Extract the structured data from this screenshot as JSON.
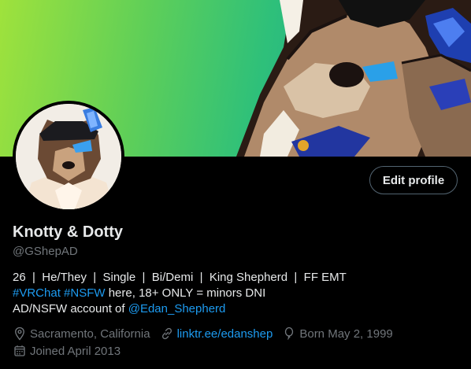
{
  "profile": {
    "display_name": "Knotty & Dotty",
    "handle": "@GShepAD",
    "edit_button_label": "Edit profile",
    "bio": {
      "line1": "26  |  He/They  |  Single  |  Bi/Demi  |  King Shepherd  |  FF EMT",
      "hashtag_vrchat": "#VRChat",
      "hashtag_nsfw": "#NSFW",
      "line2_rest": " here, 18+ ONLY = minors DNI",
      "line3_prefix": "AD/NSFW account of ",
      "mention": "@Edan_Shepherd"
    },
    "location": "Sacramento, California",
    "website": "linktr.ee/edanshep",
    "birthday": "Born May 2, 1999",
    "joined": "Joined April 2013"
  },
  "icons": {
    "location": "location-pin-icon",
    "link": "link-icon",
    "birthday": "balloon-icon",
    "joined": "calendar-icon"
  },
  "colors": {
    "background": "#000000",
    "text": "#e7e9ea",
    "secondary_text": "#71767b",
    "link": "#1d9bf0",
    "button_border": "#536471"
  }
}
